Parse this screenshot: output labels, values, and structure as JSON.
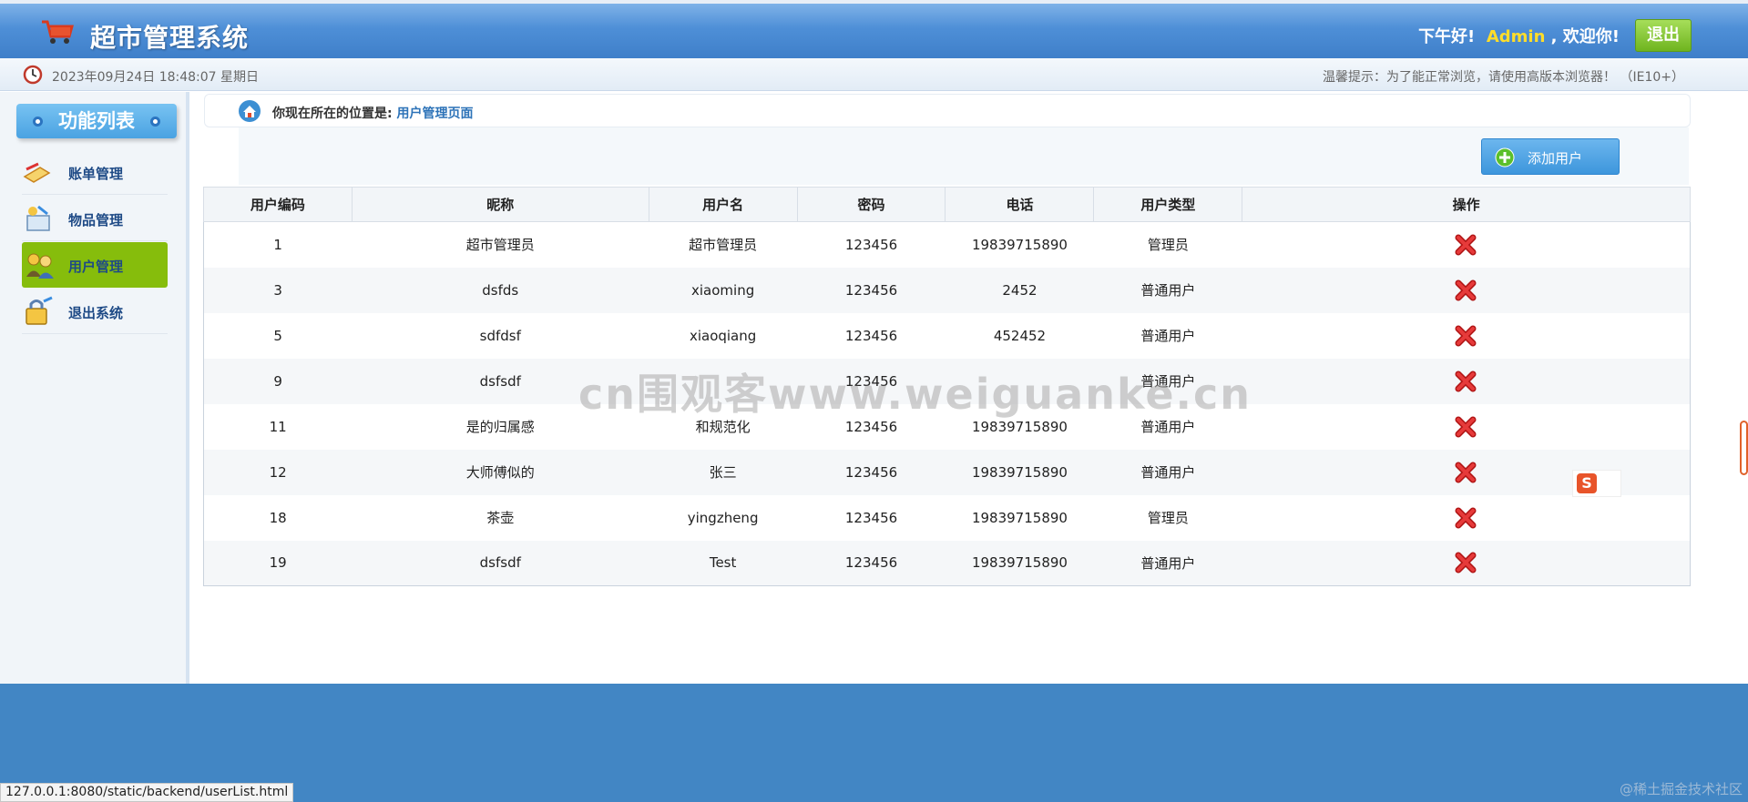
{
  "header": {
    "title": "超市管理系统",
    "greeting_prefix": "下午好!",
    "username": "Admin",
    "greeting_suffix": ", 欢迎你!",
    "logout_label": "退出"
  },
  "subbar": {
    "datetime": "2023年09月24日 18:48:07 星期日",
    "tip": "温馨提示：为了能正常浏览，请使用高版本浏览器！ （IE10+）"
  },
  "sidebar": {
    "title": "功能列表",
    "items": [
      {
        "label": "账单管理",
        "icon": "bill-icon"
      },
      {
        "label": "物品管理",
        "icon": "goods-icon"
      },
      {
        "label": "用户管理",
        "icon": "users-icon",
        "active": true
      },
      {
        "label": "退出系统",
        "icon": "lock-exit-icon"
      }
    ]
  },
  "location": {
    "label": "你现在所在的位置是:",
    "page": "用户管理页面"
  },
  "toolbar": {
    "add_user_label": "添加用户"
  },
  "table": {
    "headers": [
      "用户编码",
      "昵称",
      "用户名",
      "密码",
      "电话",
      "用户类型",
      "操作"
    ],
    "rows": [
      [
        "1",
        "超市管理员",
        "超市管理员",
        "123456",
        "19839715890",
        "管理员"
      ],
      [
        "3",
        "dsfds",
        "xiaoming",
        "123456",
        "2452",
        "普通用户"
      ],
      [
        "5",
        "sdfdsf",
        "xiaoqiang",
        "123456",
        "452452",
        "普通用户"
      ],
      [
        "9",
        "dsfsdf",
        "",
        "123456",
        "",
        "普通用户"
      ],
      [
        "11",
        "是的归属感",
        "和规范化",
        "123456",
        "19839715890",
        "普通用户"
      ],
      [
        "12",
        "大师傅似的",
        "张三",
        "123456",
        "19839715890",
        "普通用户"
      ],
      [
        "18",
        "茶壶",
        "yingzheng",
        "123456",
        "19839715890",
        "管理员"
      ],
      [
        "19",
        "dsfsdf",
        "Test",
        "123456",
        "19839715890",
        "普通用户"
      ]
    ],
    "action_icon": "delete-x-icon"
  },
  "overlays": {
    "watermark": "cn围观客www.weiguanke.cn",
    "status_url": "127.0.0.1:8080/static/backend/userList.html",
    "corner_note": "@稀土掘金技术社区",
    "ime_letter": "S"
  },
  "colors": {
    "header_blue": "#4e8fd7",
    "active_green": "#86bd0c",
    "logout_green": "#6fb41f",
    "admin_yellow": "#ffdd2a",
    "delete_red": "#d81e1e",
    "bottom_blue": "#4286c4"
  }
}
